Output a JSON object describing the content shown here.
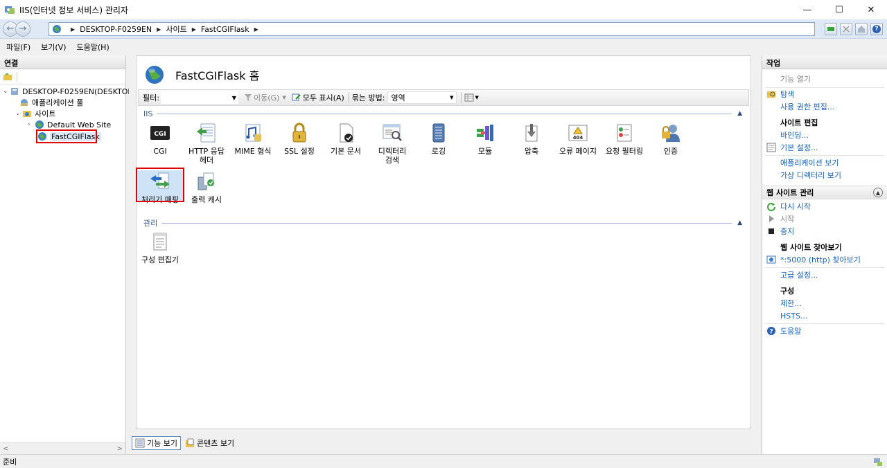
{
  "window": {
    "title": "IIS(인터넷 정보 서비스) 관리자",
    "minimize": "—",
    "maximize": "☐",
    "close": "✕"
  },
  "address": {
    "back": "←",
    "forward": "→",
    "crumbs": [
      "DESKTOP-F0259EN",
      "사이트",
      "FastCGIFlask"
    ],
    "separator": "▶",
    "help": "?"
  },
  "menu": [
    "파일(F)",
    "보기(V)",
    "도움말(H)"
  ],
  "connections": {
    "title": "연결",
    "tree": [
      {
        "label": "DESKTOP-F0259EN(DESKTOP",
        "toggle": "⌄",
        "icon": "server-icon"
      },
      {
        "label": "애플리케이션 풀",
        "toggle": "",
        "icon": "app-pool-icon"
      },
      {
        "label": "사이트",
        "toggle": "⌄",
        "icon": "sites-folder-icon"
      },
      {
        "label": "Default Web Site",
        "toggle": "›",
        "icon": "globe-icon"
      },
      {
        "label": "FastCGIFlask",
        "toggle": "",
        "icon": "globe-icon"
      }
    ],
    "scroll_left": "<",
    "scroll_right": ">"
  },
  "center": {
    "title": "FastCGIFlask 홈",
    "filter": {
      "label": "필터:",
      "go": "이동(G)",
      "show_all": "모두 표시(A)",
      "group_label": "묶는 방법:",
      "group_value": "영역"
    },
    "groups": {
      "iis": "IIS",
      "management": "관리",
      "collapse": "▲"
    },
    "features_iis_row1": [
      {
        "label": "CGI",
        "icon": "cgi-icon"
      },
      {
        "label": "HTTP 응답\n헤더",
        "icon": "http-headers-icon"
      },
      {
        "label": "MIME 형식",
        "icon": "mime-types-icon"
      },
      {
        "label": "SSL 설정",
        "icon": "ssl-lock-icon"
      },
      {
        "label": "기본 문서",
        "icon": "default-document-icon"
      },
      {
        "label": "디렉터리\n검색",
        "icon": "directory-browsing-icon"
      },
      {
        "label": "로깅",
        "icon": "logging-icon"
      },
      {
        "label": "모듈",
        "icon": "modules-icon"
      },
      {
        "label": "압축",
        "icon": "compression-icon"
      },
      {
        "label": "오류 페이지",
        "icon": "error-pages-icon"
      },
      {
        "label": "요청 필터링",
        "icon": "request-filtering-icon"
      },
      {
        "label": "인증",
        "icon": "authentication-icon"
      }
    ],
    "features_iis_row2": [
      {
        "label": "처리기 매핑",
        "icon": "handler-mappings-icon"
      },
      {
        "label": "출력 캐시",
        "icon": "output-caching-icon"
      }
    ],
    "features_mgmt": [
      {
        "label": "구성 편집기",
        "icon": "configuration-editor-icon"
      }
    ],
    "view_tabs": [
      "기능 보기",
      "콘텐츠 보기"
    ]
  },
  "actions": {
    "title": "작업",
    "open_feature": "기능 열기",
    "explore": "탐색",
    "edit_permissions": "사용 권한 편집...",
    "edit_site": "사이트 편집",
    "bindings": "바인딩...",
    "basic_settings": "기본 설정...",
    "view_apps": "애플리케이션 보기",
    "view_vdirs": "가상 디렉터리 보기",
    "manage_site": "웹 사이트 관리",
    "collapse": "▲",
    "restart": "다시 시작",
    "start": "시작",
    "stop": "중지",
    "browse_site": "웹 사이트 찾아보기",
    "browse_5000": "*:5000 (http) 찾아보기",
    "advanced_settings": "고급 설정...",
    "configure": "구성",
    "limits": "제한...",
    "hsts": "HSTS...",
    "help": "도움말"
  },
  "status": {
    "text": "준비"
  }
}
